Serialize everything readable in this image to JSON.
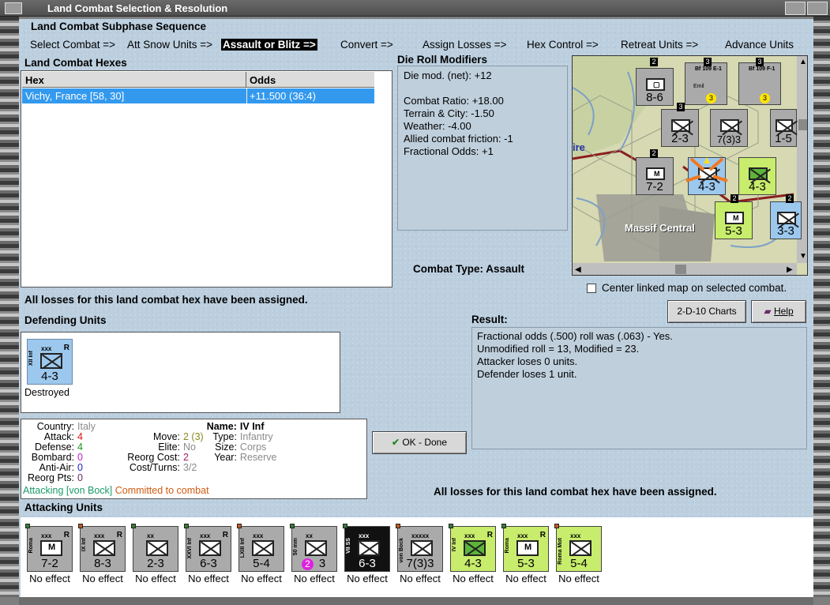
{
  "window": {
    "title": "Land Combat Selection & Resolution"
  },
  "subphase": {
    "heading": "Land Combat Subphase Sequence",
    "steps": [
      "Select Combat =>",
      "Att Snow Units =>",
      "Assault or Blitz =>",
      "Convert =>",
      "Assign Losses =>",
      "Hex Control =>",
      "Retreat Units =>",
      "Advance Units"
    ],
    "active": "Assault or Blitz =>"
  },
  "hexes": {
    "heading": "Land Combat Hexes",
    "columns": [
      "Hex",
      "Odds"
    ],
    "rows": [
      {
        "hex": "Vichy, France [58, 30]",
        "odds": "+11.500 (36:4)"
      }
    ]
  },
  "modifiers": {
    "heading": "Die Roll Modifiers",
    "net": "Die mod. (net): +12",
    "lines": [
      "Combat Ratio: +18.00",
      "Terrain & City: -1.50",
      "Weather: -4.00",
      "Allied combat friction: -1",
      "Fractional Odds: +1"
    ]
  },
  "combat_type": {
    "label": "Combat Type:",
    "value": "Assault"
  },
  "map": {
    "region_label": "Massif Central",
    "edge_text": "ire",
    "center_checkbox": {
      "label": "Center linked map on selected combat.",
      "checked": false
    },
    "counters": [
      {
        "strength": "8-6",
        "cls": "xxx"
      },
      {
        "strength": "2-3",
        "cls": "xx"
      },
      {
        "strength": "7(3)3",
        "cls": "xxxxx"
      },
      {
        "strength": "7-2",
        "cls": "xxx"
      },
      {
        "strength": "4-3",
        "cls": "xxx"
      },
      {
        "strength": "5-3",
        "cls": "xxx"
      },
      {
        "strength": "3-3",
        "cls": "xxx"
      },
      {
        "strength": "1-5",
        "cls": "xxx"
      }
    ],
    "aircraft": [
      {
        "name": "Bf 109 E-1",
        "value": "3",
        "extra": "Emil"
      },
      {
        "name": "Bf 109 F-1",
        "value": "3",
        "extra": ""
      }
    ],
    "stack_badges": [
      "2",
      "3",
      "3",
      "3",
      "2",
      "2",
      "2"
    ]
  },
  "buttons": {
    "charts": "2-D-10 Charts",
    "help": "Help",
    "done": "OK - Done"
  },
  "losses_note": "All losses for this land combat hex have been assigned.",
  "losses_note_bottom": "All losses for this land combat hex have been assigned.",
  "defending": {
    "heading": "Defending Units",
    "units": [
      {
        "name": "XII Inf",
        "cls": "xxx",
        "r": "R",
        "strength": "4-3",
        "status": "Destroyed",
        "color": "#9cc8ee"
      }
    ]
  },
  "result": {
    "heading": "Result:",
    "lines": [
      "Fractional odds (.500) roll was (.063)  - Yes.",
      "Unmodified roll = 13, Modified = 23.",
      "Attacker loses 0 units.",
      "Defender loses 1 unit."
    ]
  },
  "details": {
    "country_label": "Country:",
    "country": "Italy",
    "attack_label": "Attack:",
    "attack": "4",
    "defense_label": "Defense:",
    "defense": "4",
    "bombard_label": "Bombard:",
    "bombard": "0",
    "antiair_label": "Anti-Air:",
    "antiair": "0",
    "reorg_pts_label": "Reorg Pts:",
    "reorg_pts": "0",
    "name_label": "Name:",
    "name": "IV Inf",
    "move_label": "Move:",
    "move": "2 (3)",
    "type_label": "Type:",
    "type": "Infantry",
    "elite_label": "Elite:",
    "elite": "No",
    "size_label": "Size:",
    "size": "Corps",
    "reorg_cost_label": "Reorg Cost:",
    "reorg_cost": "2",
    "year_label": "Year:",
    "year": "Reserve",
    "cost_label": "Cost/Turns:",
    "cost": "3/2",
    "attacking_text": "Attacking [von Bock]",
    "committed_text": "Committed to combat"
  },
  "attacking": {
    "heading": "Attacking Units",
    "units": [
      {
        "name": "Roma",
        "cls": "xxx",
        "r": "R",
        "strength": "7-2",
        "status": "No effect",
        "color": "#aaaaaa",
        "sym": "M"
      },
      {
        "name": "IX Inf",
        "cls": "xxx",
        "r": "R",
        "strength": "8-3",
        "status": "No effect",
        "color": "#aaaaaa",
        "sym": ""
      },
      {
        "name": "",
        "cls": "xx",
        "r": "",
        "strength": "2-3",
        "status": "No effect",
        "color": "#aaaaaa",
        "sym": ""
      },
      {
        "name": "XXVI Inf",
        "cls": "xxx",
        "r": "R",
        "strength": "6-3",
        "status": "No effect",
        "color": "#aaaaaa",
        "sym": ""
      },
      {
        "name": "LXIII Inf",
        "cls": "xxx",
        "r": "",
        "strength": "5-4",
        "status": "No effect",
        "color": "#aaaaaa",
        "sym": ""
      },
      {
        "name": "50 mm",
        "cls": "xx",
        "r": "",
        "strength": "3",
        "status": "No effect",
        "color": "#aaaaaa",
        "sym": "",
        "badge": "2"
      },
      {
        "name": "VII SS",
        "cls": "xxx",
        "r": "",
        "strength": "6-3",
        "status": "No effect",
        "color": "#111111",
        "sym": ""
      },
      {
        "name": "von Bock",
        "cls": "xxxxx",
        "r": "",
        "strength": "7(3)3",
        "status": "No effect",
        "color": "#aaaaaa",
        "sym": ""
      },
      {
        "name": "IV Inf",
        "cls": "xxx",
        "r": "R",
        "strength": "4-3",
        "status": "No effect",
        "color": "#c8ec6c",
        "sym": ""
      },
      {
        "name": "Roma",
        "cls": "xxx",
        "r": "R",
        "strength": "5-3",
        "status": "No effect",
        "color": "#c8ec6c",
        "sym": "M"
      },
      {
        "name": "Roma Mot",
        "cls": "xxx",
        "r": "",
        "strength": "5-4",
        "status": "No effect",
        "color": "#c8ec6c",
        "sym": ""
      }
    ]
  }
}
